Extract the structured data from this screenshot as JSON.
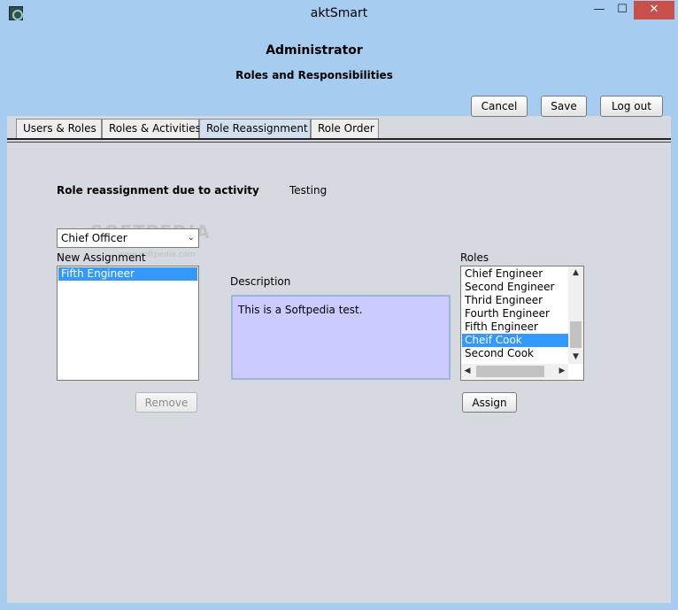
{
  "window": {
    "title": "aktSmart",
    "minimize_glyph": "—",
    "maximize_glyph": "☐",
    "close_glyph": "✕"
  },
  "header": {
    "title": "Administrator",
    "subtitle": "Roles and Responsibilities"
  },
  "toolbar": {
    "cancel_label": "Cancel",
    "save_label": "Save",
    "logout_label": "Log out"
  },
  "tabs": [
    {
      "label": "Users & Roles",
      "active": false
    },
    {
      "label": "Roles & Activities",
      "active": false
    },
    {
      "label": "Role Reassignment",
      "active": true
    },
    {
      "label": "Role Order",
      "active": false
    }
  ],
  "main": {
    "reassign_label": "Role reassignment due to activity",
    "activity_value": "Testing",
    "role_select_value": "Chief Officer",
    "new_assignment_label": "New Assignment",
    "new_assignment_items": [
      "Fifth Engineer"
    ],
    "description_label": "Description",
    "description_text": "This is a Softpedia test.",
    "roles_label": "Roles",
    "roles_items": [
      "Chief Engineer",
      "Second Engineer",
      "Thrid Engineer",
      "Fourth Engineer",
      "Fifth Engineer",
      "Cheif Cook",
      "Second Cook"
    ],
    "roles_selected_index": 5,
    "remove_label": "Remove",
    "assign_label": "Assign"
  },
  "watermark": {
    "text": "SOFTPEDIA",
    "sub": "www.softpedia.com"
  },
  "colors": {
    "header_bg": "#a6cdf0",
    "panel_bg": "#d6d9df",
    "selection": "#3399ff",
    "description_bg": "#cbcbff",
    "close_button": "#c7504a"
  }
}
